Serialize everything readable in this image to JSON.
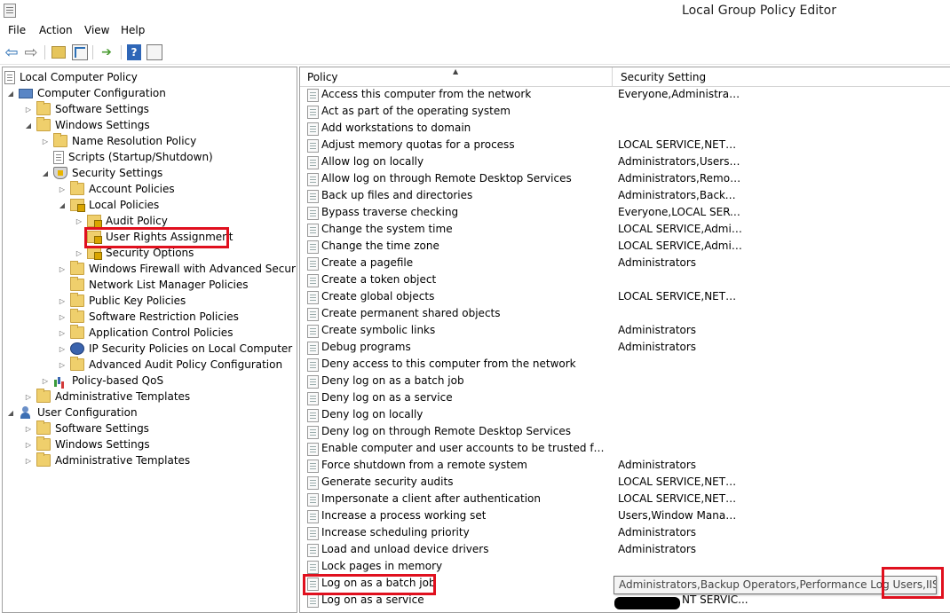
{
  "window": {
    "title": "Local Group Policy Editor"
  },
  "menu": [
    "File",
    "Action",
    "View",
    "Help"
  ],
  "toolbar": {
    "icons": [
      "back-arrow-icon",
      "forward-arrow-icon",
      "up-folder-icon",
      "show-tree-icon",
      "export-list-icon",
      "help-icon",
      "console-icon"
    ],
    "help_label": "?"
  },
  "tree": {
    "root": "Local Computer Policy",
    "computer_configuration": "Computer Configuration",
    "software_settings": "Software Settings",
    "windows_settings": "Windows Settings",
    "name_resolution_policy": "Name Resolution Policy",
    "scripts": "Scripts (Startup/Shutdown)",
    "security_settings": "Security Settings",
    "account_policies": "Account Policies",
    "local_policies": "Local Policies",
    "audit_policy": "Audit Policy",
    "user_rights_assignment": "User Rights Assignment",
    "security_options": "Security Options",
    "windows_firewall": "Windows Firewall with Advanced Security",
    "network_list_manager": "Network List Manager Policies",
    "public_key_policies": "Public Key Policies",
    "software_restriction": "Software Restriction Policies",
    "application_control": "Application Control Policies",
    "ip_security": "IP Security Policies on Local Computer",
    "advanced_audit": "Advanced Audit Policy Configuration",
    "policy_qos": "Policy-based QoS",
    "admin_templates_computer": "Administrative Templates",
    "user_configuration": "User Configuration",
    "user_software_settings": "Software Settings",
    "user_windows_settings": "Windows Settings",
    "admin_templates_user": "Administrative Templates"
  },
  "list": {
    "columns": {
      "policy": "Policy",
      "setting": "Security Setting"
    },
    "rows": [
      {
        "policy": "Access this computer from the network",
        "setting": "Everyone,Administrators..."
      },
      {
        "policy": "Act as part of the operating system",
        "setting": ""
      },
      {
        "policy": "Add workstations to domain",
        "setting": ""
      },
      {
        "policy": "Adjust memory quotas for a process",
        "setting": "LOCAL SERVICE,NETWO..."
      },
      {
        "policy": "Allow log on locally",
        "setting": "Administrators,Users,Ba..."
      },
      {
        "policy": "Allow log on through Remote Desktop Services",
        "setting": "Administrators,Remote ..."
      },
      {
        "policy": "Back up files and directories",
        "setting": "Administrators,Backup ..."
      },
      {
        "policy": "Bypass traverse checking",
        "setting": "Everyone,LOCAL SERVIC..."
      },
      {
        "policy": "Change the system time",
        "setting": "LOCAL SERVICE,Admini..."
      },
      {
        "policy": "Change the time zone",
        "setting": "LOCAL SERVICE,Admini..."
      },
      {
        "policy": "Create a pagefile",
        "setting": "Administrators"
      },
      {
        "policy": "Create a token object",
        "setting": ""
      },
      {
        "policy": "Create global objects",
        "setting": "LOCAL SERVICE,NETWO..."
      },
      {
        "policy": "Create permanent shared objects",
        "setting": ""
      },
      {
        "policy": "Create symbolic links",
        "setting": "Administrators"
      },
      {
        "policy": "Debug programs",
        "setting": "Administrators"
      },
      {
        "policy": "Deny access to this computer from the network",
        "setting": ""
      },
      {
        "policy": "Deny log on as a batch job",
        "setting": ""
      },
      {
        "policy": "Deny log on as a service",
        "setting": ""
      },
      {
        "policy": "Deny log on locally",
        "setting": ""
      },
      {
        "policy": "Deny log on through Remote Desktop Services",
        "setting": ""
      },
      {
        "policy": "Enable computer and user accounts to be trusted for delega...",
        "setting": ""
      },
      {
        "policy": "Force shutdown from a remote system",
        "setting": "Administrators"
      },
      {
        "policy": "Generate security audits",
        "setting": "LOCAL SERVICE,NETWO..."
      },
      {
        "policy": "Impersonate a client after authentication",
        "setting": "LOCAL SERVICE,NETWO..."
      },
      {
        "policy": "Increase a process working set",
        "setting": "Users,Window Manager..."
      },
      {
        "policy": "Increase scheduling priority",
        "setting": "Administrators"
      },
      {
        "policy": "Load and unload device drivers",
        "setting": "Administrators"
      },
      {
        "policy": "Lock pages in memory",
        "setting": ""
      },
      {
        "policy": "Log on as a batch job",
        "setting": ""
      },
      {
        "policy": "Log on as a service",
        "setting": "NT SERVIC..."
      }
    ],
    "tooltip": "Administrators,Backup Operators,Performance Log Users,IIS_IUSRS"
  }
}
